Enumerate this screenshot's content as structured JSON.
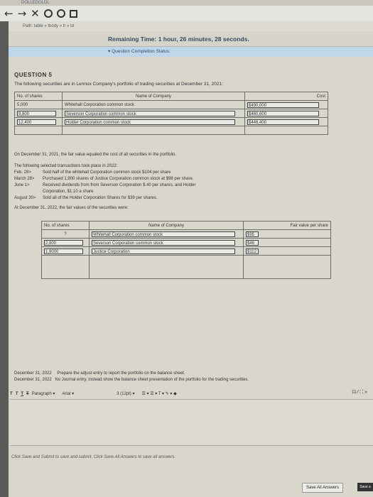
{
  "browser": {
    "top_text": "DOLLEDOLDL",
    "back": "←",
    "forward": "→",
    "close": "✕",
    "path_text": "Path: table » tbody » tr » td"
  },
  "header": {
    "timer": "Remaining Time: 1 hour, 26 minutes, 28 seconds.",
    "status": "▾ Question Completion Status:"
  },
  "question": {
    "title": "QUESTION 5",
    "intro": "The following securities are in Lennox Company's portfolio of trading securities at December 31, 2021:",
    "table1": {
      "headers": [
        "No. of shares",
        "Name of Company",
        "Cost"
      ],
      "rows": [
        [
          "5,000",
          "Whitehall Corporation common stock",
          "$490,000"
        ],
        [
          "9,800",
          "Severson Corporation common stock",
          "$460,600"
        ],
        [
          "12,400",
          "Holder Corporation common stock",
          "$446,400"
        ]
      ]
    },
    "fair_value_note": "On December 31, 2021, the fair value equaled the cost of all securities in the portfolio.",
    "transactions_intro": "The following selected transactions took place in 2022:",
    "transactions": [
      {
        "date": "Feb. 28>",
        "text": "Sold half of the whitehall Corporation common stock $104 per share"
      },
      {
        "date": "March 28>",
        "text": "Purchased 1,900 shares of Justice Corporation common stock at $98 per share."
      },
      {
        "date": "June 1>",
        "text": "Received dividends from from Severson Corporation   $.40 per shares, and Holder"
      },
      {
        "date": "",
        "text": "Corporation, $1.10 a share"
      },
      {
        "date": "August 30>",
        "text": "Sold all of the Holder Corporation Shares for $39 per shares."
      }
    ],
    "dec31_note": "At December 31, 2022, the fair values of the securities were:",
    "table2": {
      "headers": [
        "No. of shares",
        "Name of Company",
        "Fair value per share"
      ],
      "rows": [
        [
          "?",
          "Whitehall Corporation common stock",
          "$95"
        ],
        [
          "2,800",
          "Severson Corporation common stock",
          "$46"
        ],
        [
          "1,9000",
          "Justice Corporation",
          "$112"
        ]
      ]
    },
    "entries": [
      {
        "date": "December 31, 2022",
        "text": "Prepare the adjust entry to report the portfolio on the balance sheet."
      },
      {
        "date": "December 31, 2022",
        "text": "No Journal entry, instead show the balance sheet presentation of the portfolio for the trading securities."
      }
    ]
  },
  "editor": {
    "format_buttons": [
      "T",
      "T",
      "T",
      "T"
    ],
    "paragraph": "Paragraph",
    "font": "Arial",
    "size": "3 (12pt)",
    "right_icons": "⊡  ⁄  ⛶  »"
  },
  "footer": {
    "note": "Click Save and Submit to save and submit. Click Save All Answers to save all answers.",
    "save_all": "Save All Answers",
    "save_submit": "Save a"
  }
}
